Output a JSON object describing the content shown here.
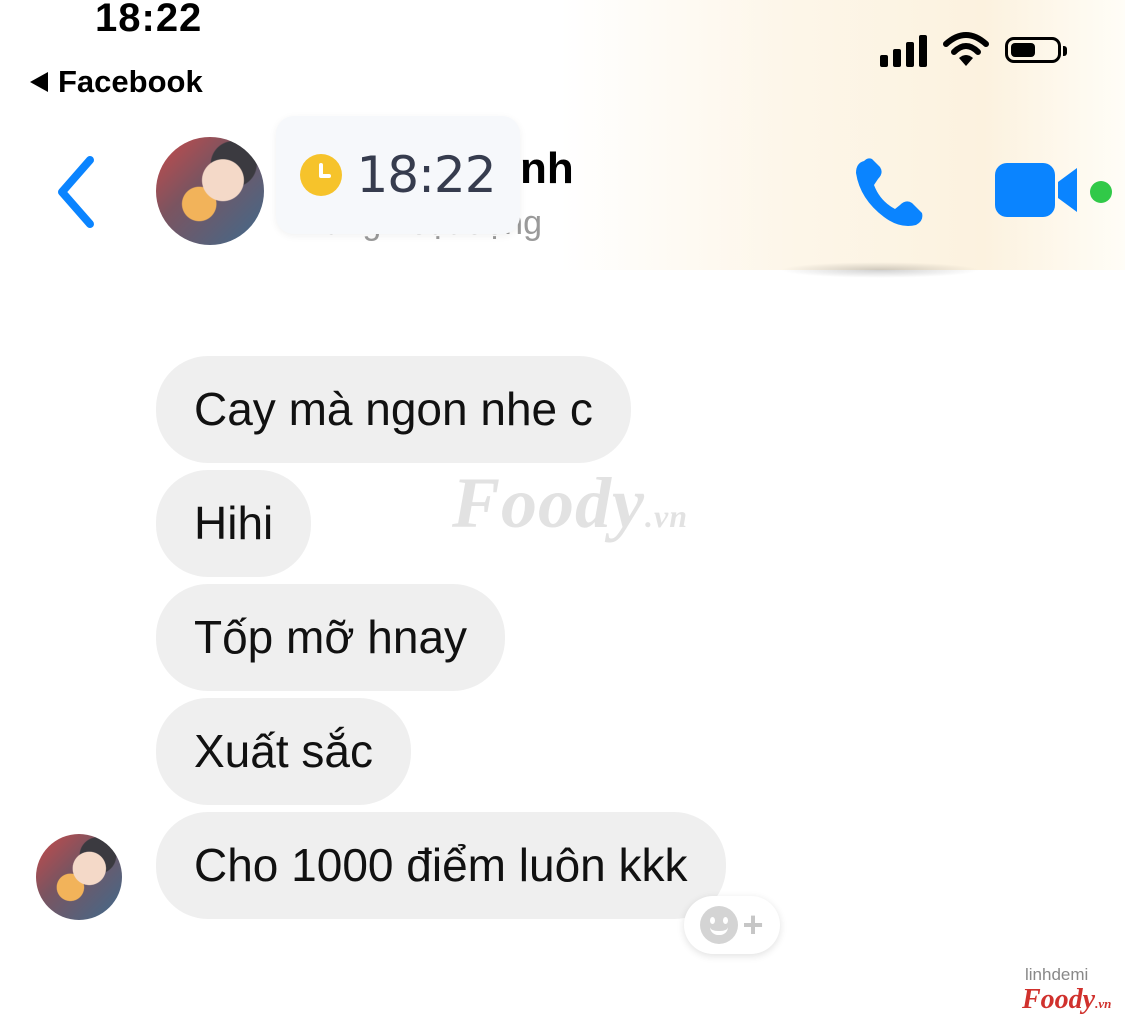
{
  "status_bar": {
    "time": "18:22",
    "back_app_label": "Facebook",
    "signal_icon": "cellular-signal-icon",
    "wifi_icon": "wifi-icon",
    "battery_icon": "battery-icon",
    "battery_level": 0.6
  },
  "header": {
    "back_icon": "chevron-left-icon",
    "contact_name_visible": "nh",
    "contact_status": "Đang hoạt động",
    "call_icon": "phone-icon",
    "video_icon": "video-camera-icon",
    "accent_color": "#0a84ff",
    "online_color": "#31c948"
  },
  "time_overlay": {
    "icon": "clock-icon",
    "time": "18:22"
  },
  "messages": [
    {
      "text": "Cay mà ngon nhe c"
    },
    {
      "text": "Hihi"
    },
    {
      "text": "Tốp mỡ hnay"
    },
    {
      "text": "Xuất sắc"
    },
    {
      "text": "Cho 1000 điểm luôn kkk"
    }
  ],
  "reaction_button": {
    "icon": "add-reaction-icon",
    "plus": "+"
  },
  "watermark": {
    "brand": "Foody",
    "suffix": ".vn"
  },
  "credit": {
    "user": "linhdemi",
    "brand": "Foody",
    "suffix": ".vn"
  }
}
